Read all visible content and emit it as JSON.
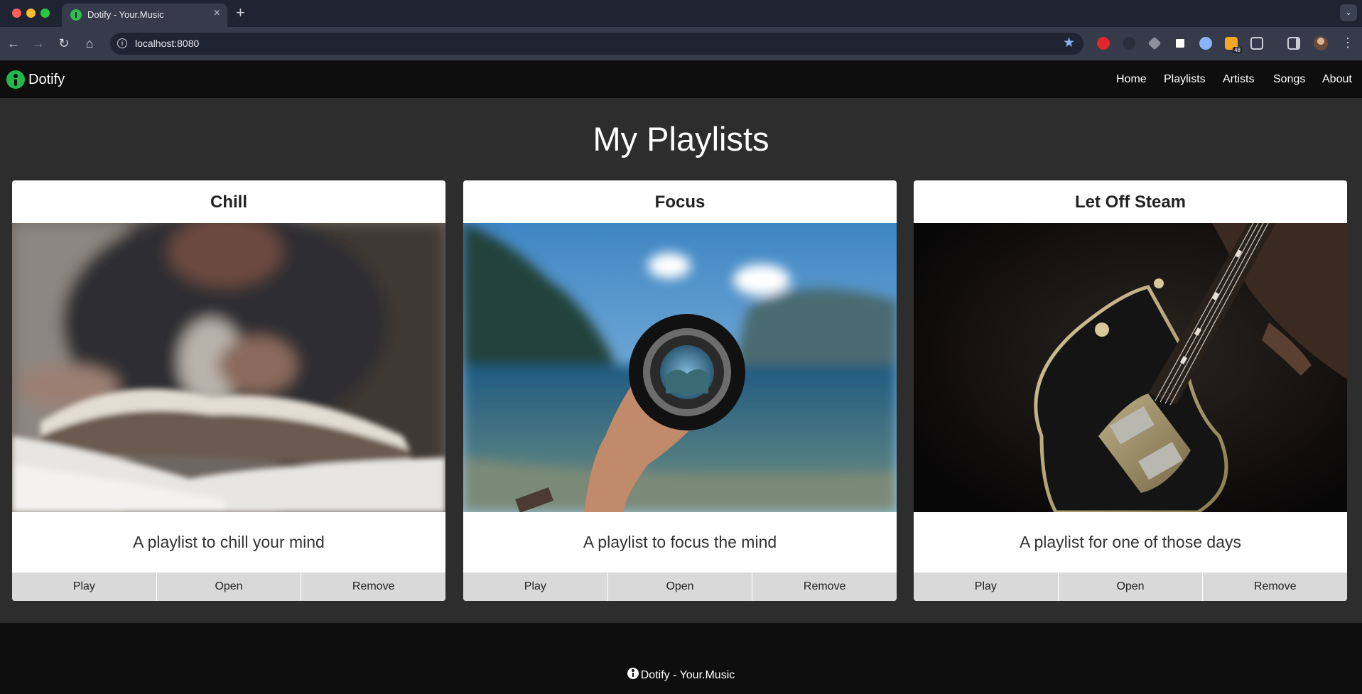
{
  "browser": {
    "tab_title": "Dotify - Your.Music",
    "url": "localhost:8080",
    "extension_badge": "48"
  },
  "header": {
    "brand": "Dotify",
    "nav": [
      "Home",
      "Playlists",
      "Artists",
      "Songs",
      "About"
    ]
  },
  "main": {
    "title": "My Playlists",
    "playlists": [
      {
        "title": "Chill",
        "description": "A playlist to chill your mind",
        "actions": [
          "Play",
          "Open",
          "Remove"
        ]
      },
      {
        "title": "Focus",
        "description": "A playlist to focus the mind",
        "actions": [
          "Play",
          "Open",
          "Remove"
        ]
      },
      {
        "title": "Let Off Steam",
        "description": "A playlist for one of those days",
        "actions": [
          "Play",
          "Open",
          "Remove"
        ]
      }
    ]
  },
  "footer": {
    "text": "Dotify - Your.Music"
  },
  "colors": {
    "brand_green": "#22b84c",
    "header_bg": "#0e0e0e",
    "page_bg": "#2d2d2d",
    "button_bg": "#d9d9d9"
  }
}
